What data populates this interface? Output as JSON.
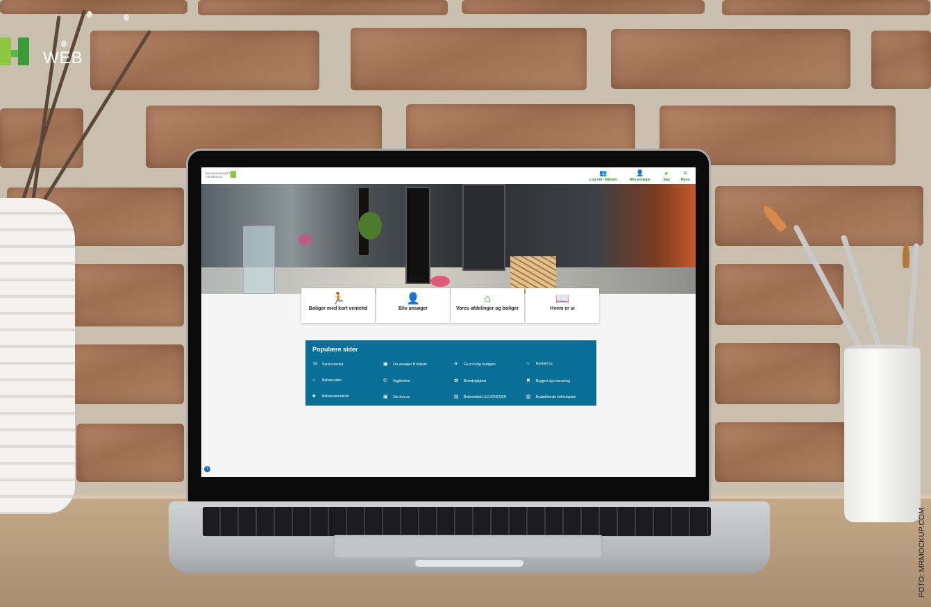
{
  "branding": {
    "label": "WEB"
  },
  "credit": "FOTO: MRMOCKUP.COM",
  "site": {
    "logo_text": "BOLIGSELSKABET FREDERICIA",
    "nav": [
      {
        "label": "Log ind - Mitside",
        "icon": "users-icon"
      },
      {
        "label": "Bliv ansøger",
        "icon": "add-user-icon"
      },
      {
        "label": "Søg",
        "icon": "search-icon"
      },
      {
        "label": "Menu",
        "icon": "menu-icon"
      }
    ],
    "tiles": [
      {
        "label": "Boliger med kort ventetid",
        "icon": "running-icon"
      },
      {
        "label": "Bliv ansøger",
        "icon": "add-user-icon"
      },
      {
        "label": "Vores afdelinger og boliger",
        "icon": "house-icon"
      },
      {
        "label": "Hvem er vi",
        "icon": "person-icon"
      }
    ],
    "popular": {
      "title": "Populære sider",
      "items": [
        {
          "label": "Servicecenter",
          "icon": "phone-icon"
        },
        {
          "label": "Fra ansøger til beboer",
          "icon": "briefcase-icon"
        },
        {
          "label": "Få en bolig hurtigere",
          "icon": "speed-icon"
        },
        {
          "label": "Kontakt os",
          "icon": "door-icon"
        },
        {
          "label": "Beboervideo",
          "icon": "house-video-icon"
        },
        {
          "label": "Vagttelefon",
          "icon": "phone-call-icon"
        },
        {
          "label": "Beredygtighed",
          "icon": "plant-icon"
        },
        {
          "label": "Byggeri og renovering",
          "icon": "tools-icon"
        },
        {
          "label": "Beboerdemokrati",
          "icon": "org-icon"
        },
        {
          "label": "Job hos os",
          "icon": "briefcase-icon"
        },
        {
          "label": "Beboerblad LEJLIGHEDEN",
          "icon": "newspaper-icon"
        },
        {
          "label": "Bydækkende helhedsplan",
          "icon": "building-icon"
        }
      ]
    },
    "info": "i"
  }
}
